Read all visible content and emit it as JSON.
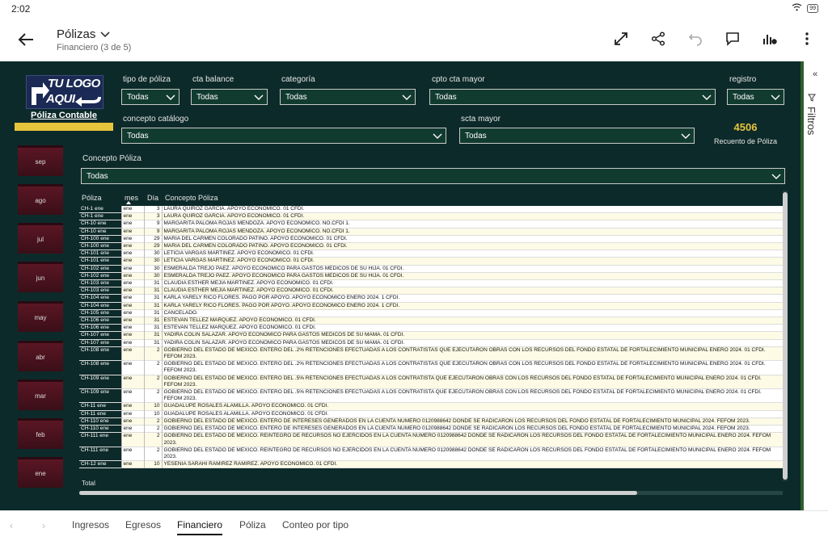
{
  "status": {
    "time": "2:02",
    "battery": "99"
  },
  "header": {
    "title": "Pólizas",
    "subtitle": "Financiero (3 de 5)"
  },
  "logo": {
    "top": "TU LOGO",
    "bottom": "AQUI",
    "caption": "Póliza Contable"
  },
  "filters": {
    "tipo_poliza": {
      "label": "tipo de póliza",
      "value": "Todas"
    },
    "cta_balance": {
      "label": "cta balance",
      "value": "Todas"
    },
    "categoria": {
      "label": "categoría",
      "value": "Todas"
    },
    "cpto_cta_mayor": {
      "label": "cpto cta mayor",
      "value": "Todas"
    },
    "registro": {
      "label": "registro",
      "value": "Todas"
    },
    "concepto_catalogo": {
      "label": "concepto catálogo",
      "value": "Todas"
    },
    "scta_mayor": {
      "label": "scta mayor",
      "value": "Todas"
    },
    "concepto_poliza": {
      "label": "Concepto Póliza",
      "value": "Todas"
    }
  },
  "count": {
    "value": "4506",
    "label": "Recuento de Póliza"
  },
  "months": [
    "sep",
    "ago",
    "jul",
    "jun",
    "may",
    "abr",
    "mar",
    "feb",
    "ene"
  ],
  "table": {
    "headers": {
      "poliza": "Póliza",
      "mes": "mes",
      "dia": "Día",
      "concepto": "Concepto Póliza"
    },
    "rows": [
      [
        "CH-1 ene",
        "ene",
        "3",
        "LAURA QUIROZ GARCIA. APOYO ECONOMICO. 01 CFDI."
      ],
      [
        "CH-1 ene",
        "ene",
        "3",
        "LAURA QUIROZ GARCIA. APOYO ECONOMICO. 01 CFDI."
      ],
      [
        "CH-10 ene",
        "ene",
        "9",
        "MARGARITA PALOMA ROJAS MENDOZA. APOYO ECONOMICO. NO.CFDI 1."
      ],
      [
        "CH-10 ene",
        "ene",
        "9",
        "MARGARITA PALOMA ROJAS MENDOZA. APOYO ECONOMICO. NO.CFDI 1."
      ],
      [
        "CH-100 ene",
        "ene",
        "29",
        "MARIA DEL CARMEN COLORADO PATINO. APOYO ECONOMICO. 01 CFDI."
      ],
      [
        "CH-100 ene",
        "ene",
        "29",
        "MARIA DEL CARMEN COLORADO PATINO. APOYO ECONOMICO. 01 CFDI."
      ],
      [
        "CH-101 ene",
        "ene",
        "30",
        "LETICIA VARGAS MARTINEZ. APOYO ECONOMICO. 01 CFDI."
      ],
      [
        "CH-101 ene",
        "ene",
        "30",
        "LETICIA VARGAS MARTINEZ. APOYO ECONOMICO. 01 CFDI."
      ],
      [
        "CH-102 ene",
        "ene",
        "30",
        "ESMERALDA TREJO PAEZ. APOYO ECONOMICO PARA GASTOS MEDICOS DE SU HIJA. 01 CFDI."
      ],
      [
        "CH-102 ene",
        "ene",
        "30",
        "ESMERALDA TREJO PAEZ. APOYO ECONOMICO PARA GASTOS MEDICOS DE SU HIJA. 01 CFDI."
      ],
      [
        "CH-103 ene",
        "ene",
        "31",
        "CLAUDIA ESTHER MEJIA MARTINEZ. APOYO ECONOMICO. 01 CFDI."
      ],
      [
        "CH-103 ene",
        "ene",
        "31",
        "CLAUDIA ESTHER MEJIA MARTINEZ. APOYO ECONOMICO. 01 CFDI."
      ],
      [
        "CH-104 ene",
        "ene",
        "31",
        "KARLA YARELY RICO FLORES. PAGO POR APOYO. APOYO ECONOMICO ENERO 2024. 1 CFDI."
      ],
      [
        "CH-104 ene",
        "ene",
        "31",
        "KARLA YARELY RICO FLORES. PAGO POR APOYO. APOYO ECONOMICO ENERO 2024. 1 CFDI."
      ],
      [
        "CH-105 ene",
        "ene",
        "31",
        "CANCELADO."
      ],
      [
        "CH-106 ene",
        "ene",
        "31",
        "ESTEVAN TELLEZ MARQUEZ. APOYO ECONOMICO. 01 CFDI."
      ],
      [
        "CH-106 ene",
        "ene",
        "31",
        "ESTEVAN TELLEZ MARQUEZ. APOYO ECONOMICO. 01 CFDI."
      ],
      [
        "CH-107 ene",
        "ene",
        "31",
        "YADIRA COLIN SALAZAR. APOYO ECONOMICO PARA GASTOS MEDICOS DE SU MAMA. 01 CFDI."
      ],
      [
        "CH-107 ene",
        "ene",
        "31",
        "YADIRA COLIN SALAZAR. APOYO ECONOMICO PARA GASTOS MEDICOS DE SU MAMA. 01 CFDI."
      ],
      [
        "CH-108 ene",
        "ene",
        "2",
        "GOBIERNO DEL ESTADO DE MEXICO. ENTERO DEL .2% RETENCIONES EFECTUADAS A LOS CONTRATISTAS QUE EJECUTARON OBRAS CON LOS RECURSOS DEL FONDO ESTATAL DE FORTALECIMIENTO MUNICIPAL ENERO 2024. 01 CFDI. FEFOM 2023."
      ],
      [
        "CH-108 ene",
        "ene",
        "2",
        "GOBIERNO DEL ESTADO DE MEXICO. ENTERO DEL .2% RETENCIONES EFECTUADAS A LOS CONTRATISTAS QUE EJECUTARON OBRAS CON LOS RECURSOS DEL FONDO ESTATAL DE FORTALECIMIENTO MUNICIPAL ENERO 2024. 01 CFDI. FEFOM 2023."
      ],
      [
        "CH-109 ene",
        "ene",
        "2",
        "GOBIERNO DEL ESTADO DE MEXICO. ENTERO DEL .5% RETENCIONES EFECTUADAS A LOS CONTRATISTA QUE EJECUTARON OBRAS CON LOS RECURSOS DEL FONDO ESTATAL DE FORTALECIMIENTO MUNICIPAL ENERO 2024. 01 CFDI. FEFOM 2023."
      ],
      [
        "CH-109 ene",
        "ene",
        "2",
        "GOBIERNO DEL ESTADO DE MEXICO. ENTERO DEL .5% RETENCIONES EFECTUADAS A LOS CONTRATISTA QUE EJECUTARON OBRAS CON LOS RECURSOS DEL FONDO ESTATAL DE FORTALECIMIENTO MUNICIPAL ENERO 2024. 01 CFDI. FEFOM 2023."
      ],
      [
        "CH-11 ene",
        "ene",
        "10",
        "GUADALUPE ROSALES ALAMILLA. APOYO ECONOMICO. 01 CFDI."
      ],
      [
        "CH-11 ene",
        "ene",
        "10",
        "GUADALUPE ROSALES ALAMILLA. APOYO ECONOMICO. 01 CFDI."
      ],
      [
        "CH-110 ene",
        "ene",
        "2",
        "GOBIERNO DEL ESTADO DE MEXICO. ENTERO DE INTERESES GENERADOS EN LA CUENTA NUMERO 0120988642 DONDE SE RADICARON LOS RECURSOS DEL FONDO ESTATAL DE FORTALECIMIENTO MUNICIPAL 2024. FEFOM 2023."
      ],
      [
        "CH-110 ene",
        "ene",
        "2",
        "GOBIERNO DEL ESTADO DE MEXICO. ENTERO DE INTERESES GENERADOS EN LA CUENTA NUMERO 0120988642 DONDE SE RADICARON LOS RECURSOS DEL FONDO ESTATAL DE FORTALECIMIENTO MUNICIPAL 2024. FEFOM 2023."
      ],
      [
        "CH-111 ene",
        "ene",
        "2",
        "GOBIERNO DEL ESTADO DE MEXICO. REINTEGRO DE RECURSOS NO EJERCIDOS EN LA CUENTA NUMERO 0120988642 DONDE SE RADICARON LOS RECURSOS DEL FONDO ESTATAL DE FORTALECIMIENTO MUNICIPAL ENERO 2024. FEFOM 2023."
      ],
      [
        "CH-111 ene",
        "ene",
        "2",
        "GOBIERNO DEL ESTADO DE MEXICO. REINTEGRO DE RECURSOS NO EJERCIDOS EN LA CUENTA NUMERO 0120988642 DONDE SE RADICARON LOS RECURSOS DEL FONDO ESTATAL DE FORTALECIMIENTO MUNICIPAL ENERO 2024. FEFOM 2023."
      ],
      [
        "CH-12 ene",
        "ene",
        "10",
        "YESENIA SARAHI RAMIREZ RAMIREZ. APOYO ECONOMICO. 01 CFDI."
      ]
    ],
    "total_label": "Total"
  },
  "filters_pane": {
    "label": "Filtros"
  },
  "tabs": [
    "Ingresos",
    "Egresos",
    "Financiero",
    "Póliza",
    "Conteo por tipo"
  ],
  "active_tab": "Financiero",
  "colors": {
    "canvas": "#0d2a2a",
    "accent": "#e6c43c",
    "month_tile": "#5a1624",
    "dropdown": "#123b30"
  }
}
